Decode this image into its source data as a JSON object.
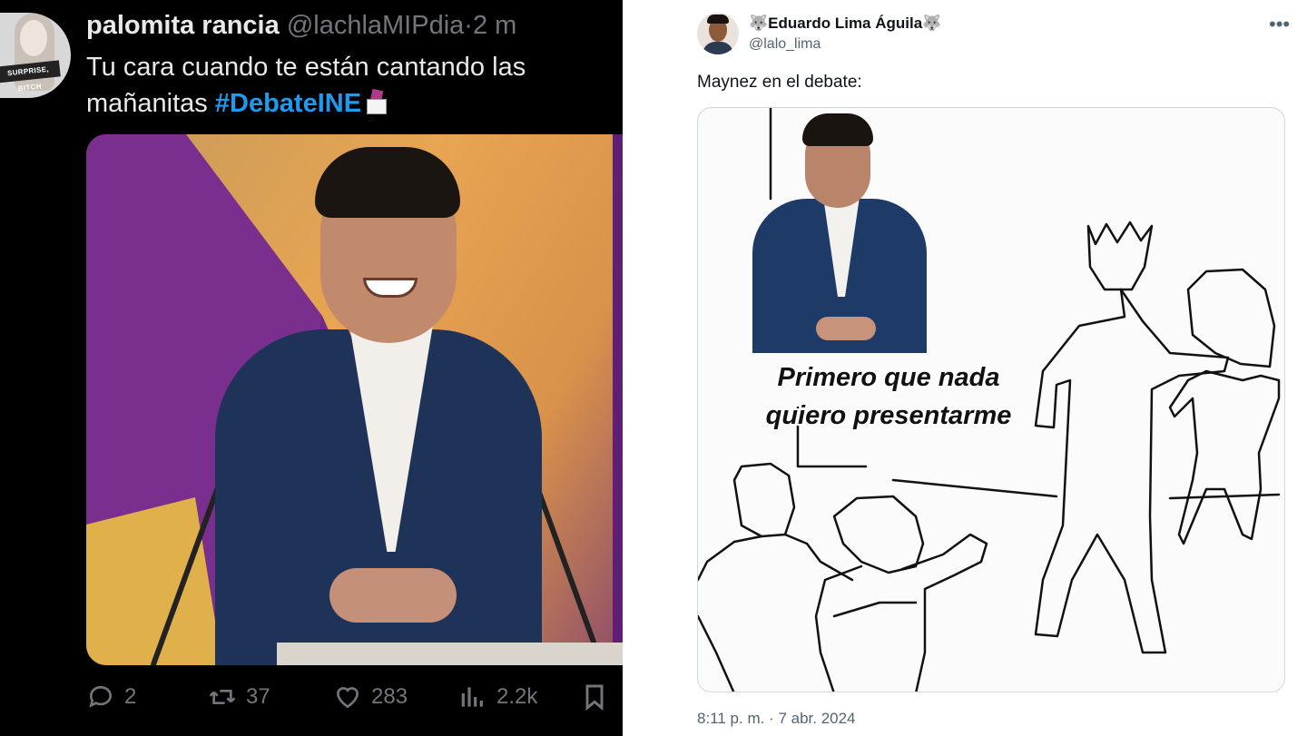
{
  "left_tweet": {
    "avatar_sign_text": "SURPRISE, BITCH",
    "display_name": "palomita rancia",
    "handle": "@lachlaMIPdia",
    "separator": "·",
    "time_ago": "2 m",
    "more_icon": "more-horizontal-icon",
    "text": "Tu cara cuando te están cantando las mañanitas",
    "hashtag": "#DebateINE",
    "hashtag_color": "#1d9bf0",
    "actions": {
      "replies": "2",
      "reposts": "37",
      "likes": "283",
      "views": "2.2k"
    }
  },
  "right_tweet": {
    "display_name": "🐺Eduardo Lima Águila🐺",
    "handle": "@lalo_lima",
    "text": "Maynez en el debate:",
    "meme_caption_line1": "Primero que nada",
    "meme_caption_line2": "quiero presentarme",
    "timestamp": "8:11 p. m. · 7 abr. 2024"
  },
  "colors": {
    "dark_bg": "#000000",
    "dark_text": "#e7e9ea",
    "muted_dark": "#71767b",
    "light_text": "#0f1419",
    "muted_light": "#536471"
  }
}
